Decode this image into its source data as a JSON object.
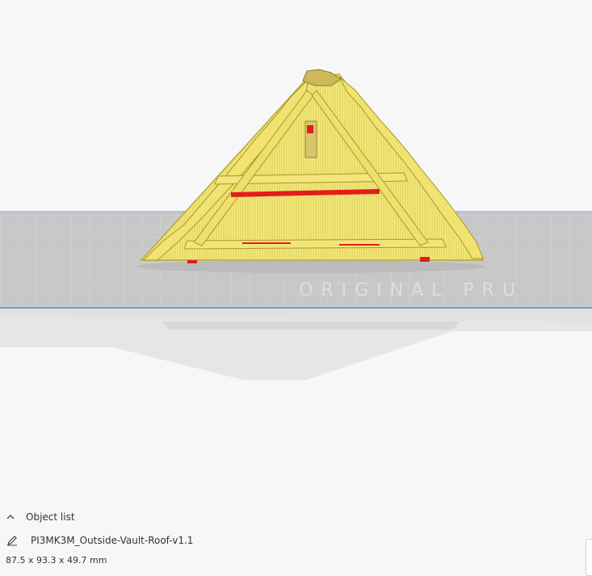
{
  "viewport": {
    "build_plate_watermark": "ORIGINAL PRU"
  },
  "object_list": {
    "header_label": "Object list",
    "collapse_icon": "chevron-up-icon",
    "edit_icon": "pencil-icon",
    "object_name": "PI3MK3M_Outside-Vault-Roof-v1.1",
    "dimensions": "87.5 x 93.3 x 49.7 mm"
  },
  "colors": {
    "model_fill": "#f6eb7e",
    "model_stroke": "#b8a83a",
    "overhang_highlight": "#e31c1c",
    "plate": "#c6c6c6",
    "plate_grid": "#d9d9d9",
    "plate_edge": "#5b8fd6",
    "background": "#f7f7f7"
  }
}
